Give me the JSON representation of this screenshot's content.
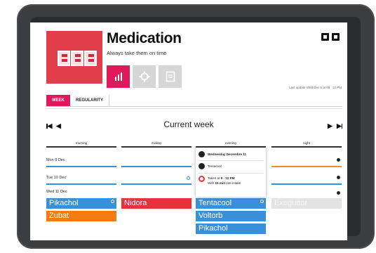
{
  "app": {
    "title": "Medication",
    "subtitle": "Always take them on time",
    "last_update": "Last update Wed Dec 6 at 09 : 12 PM",
    "accent_color": "#e0195a"
  },
  "view_buttons": [
    {
      "icon": "bar-chart-icon",
      "active": true
    },
    {
      "icon": "gear-icon",
      "active": false
    },
    {
      "icon": "document-icon",
      "active": false
    }
  ],
  "window_controls": [
    {
      "icon": "minimize-icon"
    },
    {
      "icon": "maximize-icon"
    }
  ],
  "tabs": [
    {
      "label": "WEEK",
      "active": true
    },
    {
      "label": "REGULARITY",
      "active": false
    }
  ],
  "week_nav": {
    "title": "Current week",
    "first_glyph": "◀",
    "prev_glyph": "◀",
    "next_glyph": "▶",
    "last_glyph": "▶"
  },
  "columns": [
    "morning",
    "midday",
    "evening",
    "night"
  ],
  "days": [
    "Mon 9 Dec",
    "Tue 10 Dec",
    "Wed 11 Dec"
  ],
  "meds": {
    "morning": [
      "Pikachol",
      "Zubat"
    ],
    "midday": [
      "Nidora"
    ],
    "evening": [
      "Tentacool",
      "Voltorb",
      "Pikachol"
    ],
    "night": [
      "Exeguttor"
    ]
  },
  "popover": {
    "date": "Wednesday Decembre 11",
    "med": "Tentacool",
    "taken_prefix": "Taken at",
    "taken_time": "9 : 12 PM",
    "with_prefix": "With",
    "delay": "15 min",
    "delay_suffix": "late intake"
  }
}
